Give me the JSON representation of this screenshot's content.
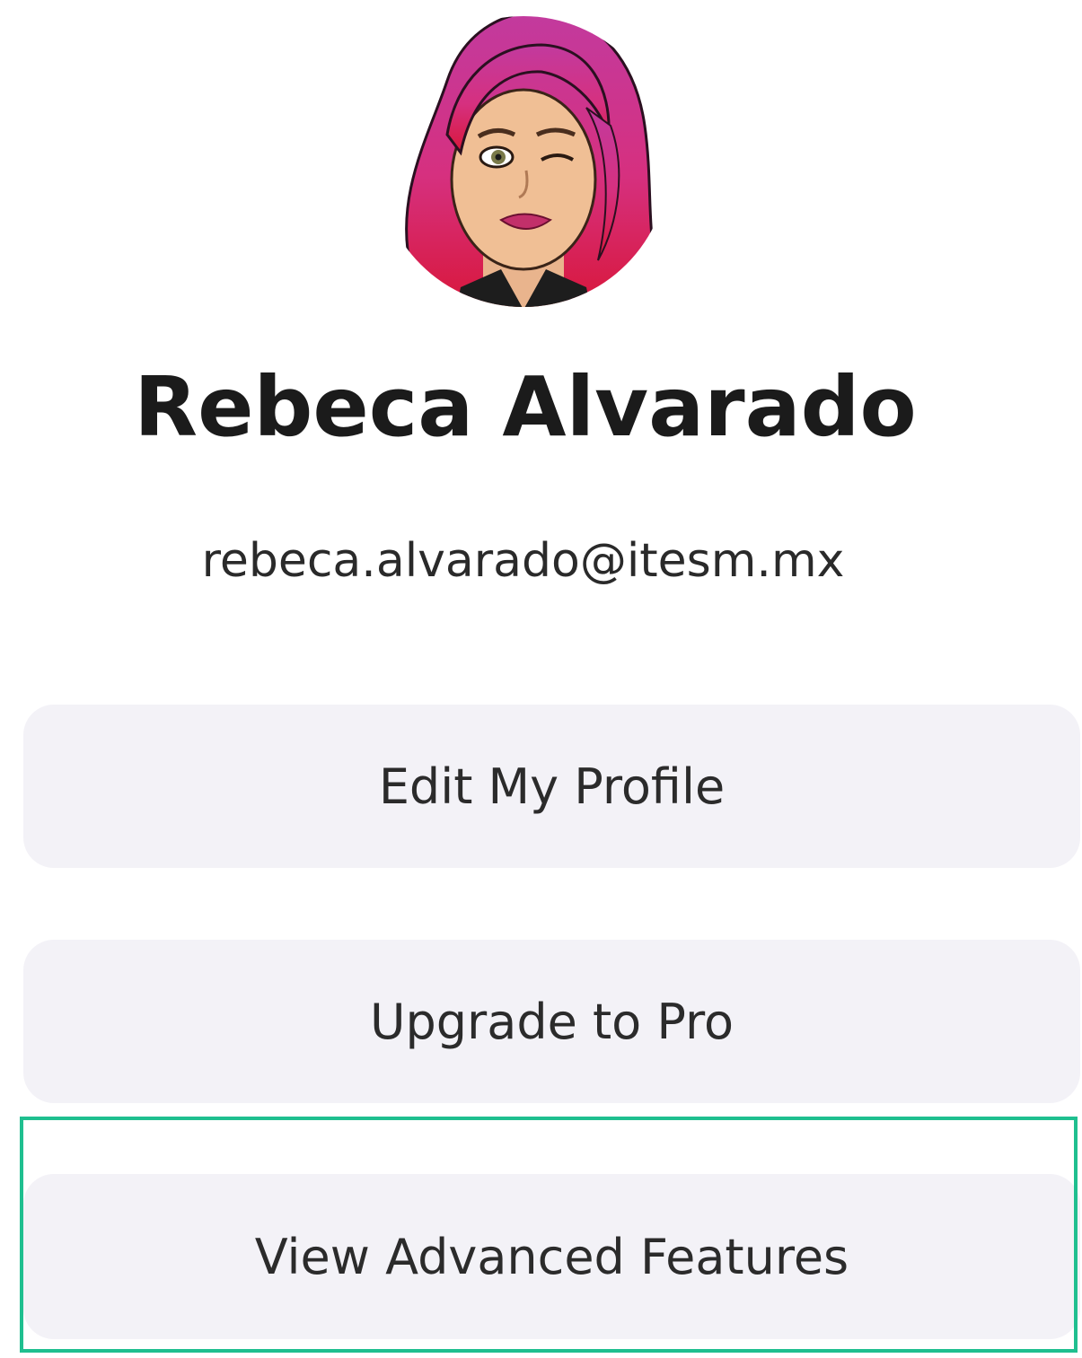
{
  "profile": {
    "avatar_icon": "bitmoji-avatar-icon",
    "name": "Rebeca Alvarado",
    "email": "rebeca.alvarado@itesm.mx"
  },
  "menu": {
    "items": [
      {
        "label": "Edit My Profile"
      },
      {
        "label": "Upgrade to Pro"
      },
      {
        "label": "View Advanced Features"
      }
    ],
    "highlighted_index": 2
  },
  "colors": {
    "button_bg": "#f3f2f7",
    "highlight": "#1fbf8f",
    "hair": "#c8308c",
    "text": "#1b1b1b"
  }
}
